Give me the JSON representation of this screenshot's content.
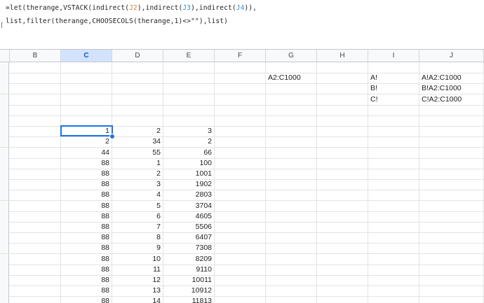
{
  "formula": {
    "line1_a": "=let(therange,VSTACK(indirect(",
    "line1_ref1": "J2",
    "line1_b": "),indirect(",
    "line1_ref2": "J3",
    "line1_c": "),indirect(",
    "line1_ref3": "J4",
    "line1_d": ")),",
    "line2": "list,filter(therange,CHOOSECOLS(therange,1)<>\"\"),list)"
  },
  "columns": [
    "B",
    "C",
    "D",
    "E",
    "F",
    "G",
    "H",
    "I",
    "J"
  ],
  "selected_column": "C",
  "info_rows": [
    {
      "G": "A2:C1000",
      "I": "A!",
      "J": "A!A2:C1000"
    },
    {
      "G": "",
      "I": "B!",
      "J": "B!A2:C1000"
    },
    {
      "G": "",
      "I": "C!",
      "J": "C!A2:C1000"
    }
  ],
  "data_rows": [
    [
      "1",
      "2",
      "3"
    ],
    [
      "2",
      "34",
      "2"
    ],
    [
      "44",
      "55",
      "66"
    ],
    [
      "88",
      "1",
      "100"
    ],
    [
      "88",
      "2",
      "1001"
    ],
    [
      "88",
      "3",
      "1902"
    ],
    [
      "88",
      "4",
      "2803"
    ],
    [
      "88",
      "5",
      "3704"
    ],
    [
      "88",
      "6",
      "4605"
    ],
    [
      "88",
      "7",
      "5506"
    ],
    [
      "88",
      "8",
      "6407"
    ],
    [
      "88",
      "9",
      "7308"
    ],
    [
      "88",
      "10",
      "8209"
    ],
    [
      "88",
      "11",
      "9110"
    ],
    [
      "88",
      "12",
      "10011"
    ],
    [
      "88",
      "13",
      "10912"
    ],
    [
      "88",
      "14",
      "11813"
    ]
  ],
  "colors": {
    "accent": "#1a73e8",
    "ref_orange": "#d5822a",
    "ref_blue": "#3b8fd6"
  }
}
